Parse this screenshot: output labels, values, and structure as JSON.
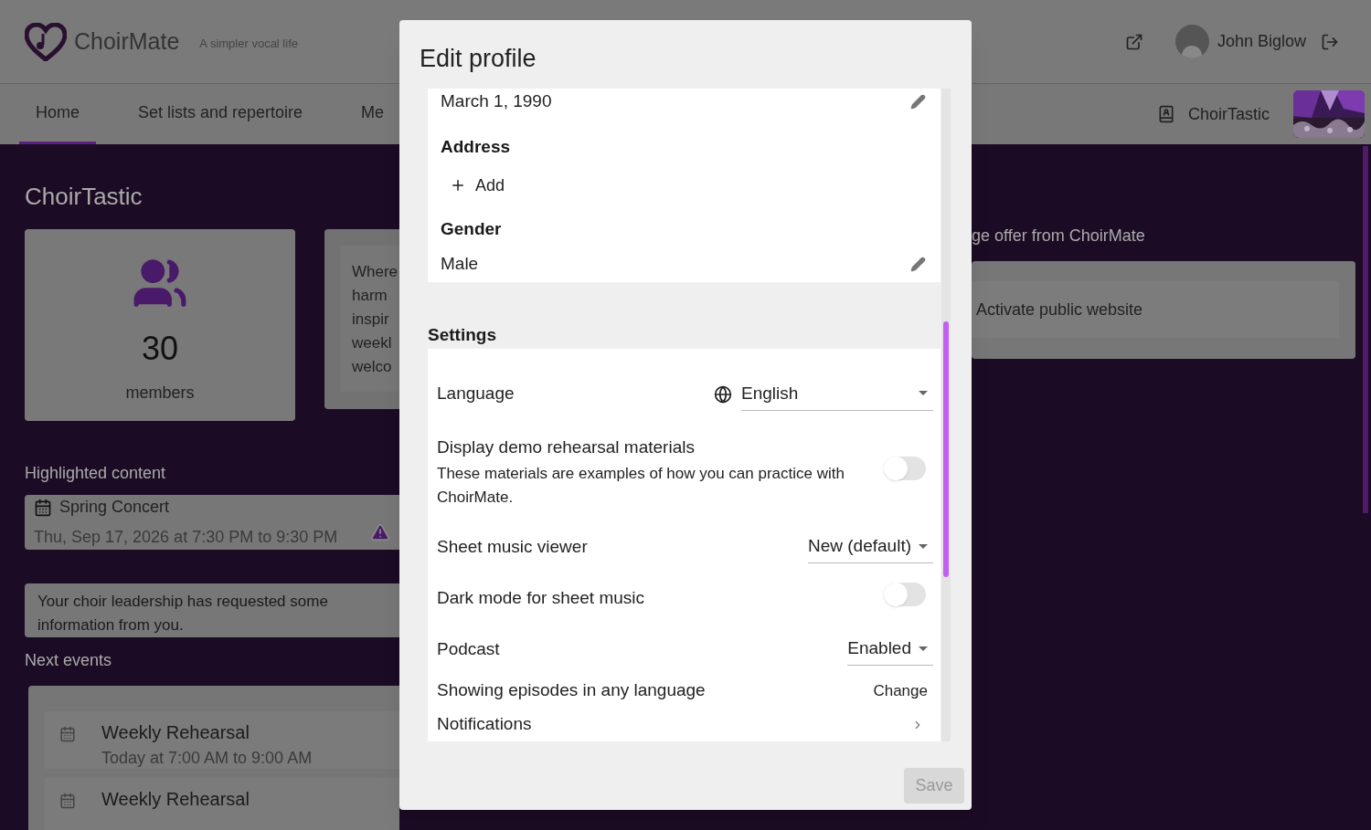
{
  "header": {
    "logo_text": "ChoirMate",
    "tagline": "A simpler vocal life",
    "user_name": "John Biglow"
  },
  "nav": {
    "tabs": [
      {
        "label": "Home",
        "selected": true
      },
      {
        "label": "Set lists and repertoire",
        "selected": false
      },
      {
        "label": "Me",
        "selected": false
      }
    ],
    "choir_name": "ChoirTastic"
  },
  "page": {
    "title": "ChoirTastic",
    "members_count": "30",
    "members_label": "members",
    "about_lines": [
      "Where",
      "harm",
      "inspir",
      "weekl",
      "welco"
    ],
    "highlighted_heading": "Highlighted content",
    "highlighted": {
      "title": "Spring Concert",
      "time": "Thu, Sep 17, 2026 at 7:30 PM to 9:30 PM"
    },
    "info_request": "Your choir leadership has requested some information from you.",
    "next_events_heading": "Next events",
    "events": [
      {
        "title": "Weekly Rehearsal",
        "time": "Today at 7:00 AM to 9:00 AM"
      },
      {
        "title": "Weekly Rehearsal"
      }
    ],
    "offer_heading": "ge offer from ChoirMate",
    "offer_action": "Activate public website"
  },
  "dialog": {
    "title": "Edit profile",
    "birthdate": "March 1, 1990",
    "address_label": "Address",
    "add_label": "Add",
    "gender_label": "Gender",
    "gender": "Male",
    "settings_heading": "Settings",
    "settings": [
      {
        "kind": "language",
        "label": "Language",
        "value": "English"
      },
      {
        "kind": "toggle",
        "label": "Display demo rehearsal materials",
        "description": "These materials are examples of how you can practice with ChoirMate.",
        "on": false
      },
      {
        "kind": "select",
        "label": "Sheet music viewer",
        "value": "New (default)"
      },
      {
        "kind": "toggle",
        "label": "Dark mode for sheet music",
        "on": false
      },
      {
        "kind": "select",
        "label": "Podcast",
        "value": "Enabled"
      },
      {
        "kind": "action",
        "label": "Showing episodes in any language",
        "action": "Change"
      },
      {
        "kind": "link",
        "label": "Notifications"
      }
    ],
    "save": {
      "label": "Save",
      "disabled": true
    }
  }
}
